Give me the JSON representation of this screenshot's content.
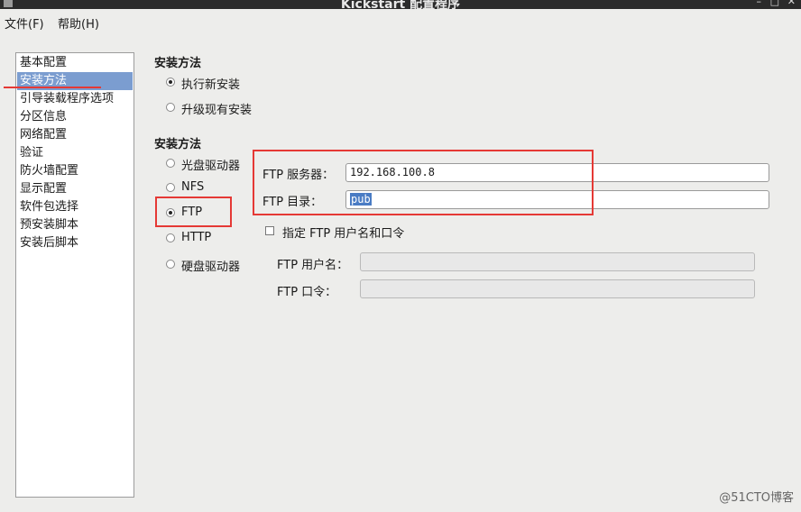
{
  "window": {
    "title": "Kickstart 配置程序",
    "controls": [
      "–",
      "□",
      "✕"
    ]
  },
  "menu": [
    "文件(F)",
    "帮助(H)"
  ],
  "sidebar": {
    "items": [
      "基本配置",
      "安装方法",
      "引导装载程序选项",
      "分区信息",
      "网络配置",
      "验证",
      "防火墙配置",
      "显示配置",
      "软件包选择",
      "预安装脚本",
      "安装后脚本"
    ],
    "selected_index": 1
  },
  "install_type": {
    "heading": "安装方法",
    "options": [
      "执行新安装",
      "升级现有安装"
    ],
    "selected_index": 0
  },
  "install_source": {
    "heading": "安装方法",
    "options": [
      "光盘驱动器",
      "NFS",
      "FTP",
      "HTTP",
      "硬盘驱动器"
    ],
    "selected_index": 2
  },
  "ftp": {
    "server_label": "FTP 服务器：",
    "server_value": "192.168.100.8",
    "dir_label": "FTP 目录：",
    "dir_value": "pub",
    "credentials_checkbox_label": "指定 FTP 用户名和口令",
    "credentials_checked": false,
    "username_label": "FTP 用户名：",
    "username_value": "",
    "password_label": "FTP 口令：",
    "password_value": ""
  },
  "watermark": "@51CTO博客",
  "colors": {
    "selection": "#7b9dd0",
    "annotation": "#e53935"
  }
}
